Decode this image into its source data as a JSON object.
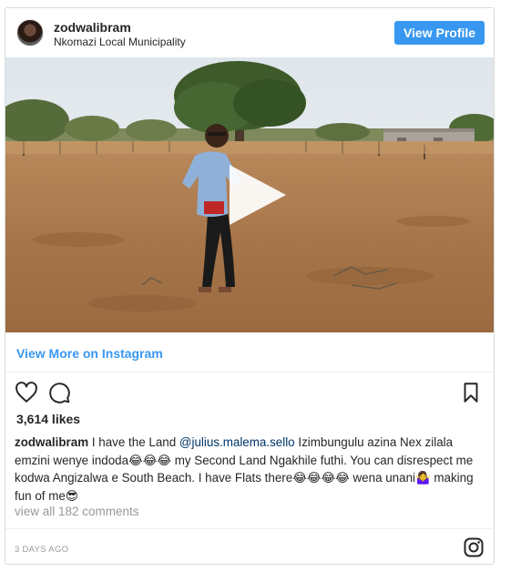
{
  "header": {
    "username": "zodwalibram",
    "location": "Nkomazi Local Municipality",
    "view_profile_label": "View Profile"
  },
  "media": {
    "type": "video",
    "play_icon": "play-icon"
  },
  "view_more_label": "View More on Instagram",
  "actions": {
    "like_icon": "heart-icon",
    "comment_icon": "comment-icon",
    "save_icon": "bookmark-icon"
  },
  "likes": "3,614 likes",
  "caption": {
    "username": "zodwalibram",
    "text_before": "I have the Land",
    "mention": "@julius.malema.sello",
    "text_after": "Izimbungulu azina Nex zilala emzini wenye indoda😂😂😂 my Second Land Ngakhile futhi. You can disrespect me kodwa Angizalwa e South Beach. I have Flats there😂😂😂😂 wena unani🤷‍♀️ making fun of me😎"
  },
  "view_comments": "view all 182 comments",
  "timestamp": "3 DAYS AGO",
  "footer_icon": "instagram-icon",
  "colors": {
    "accent": "#3897f0",
    "text": "#262626",
    "muted": "#999999",
    "border": "#dbdbdb"
  }
}
